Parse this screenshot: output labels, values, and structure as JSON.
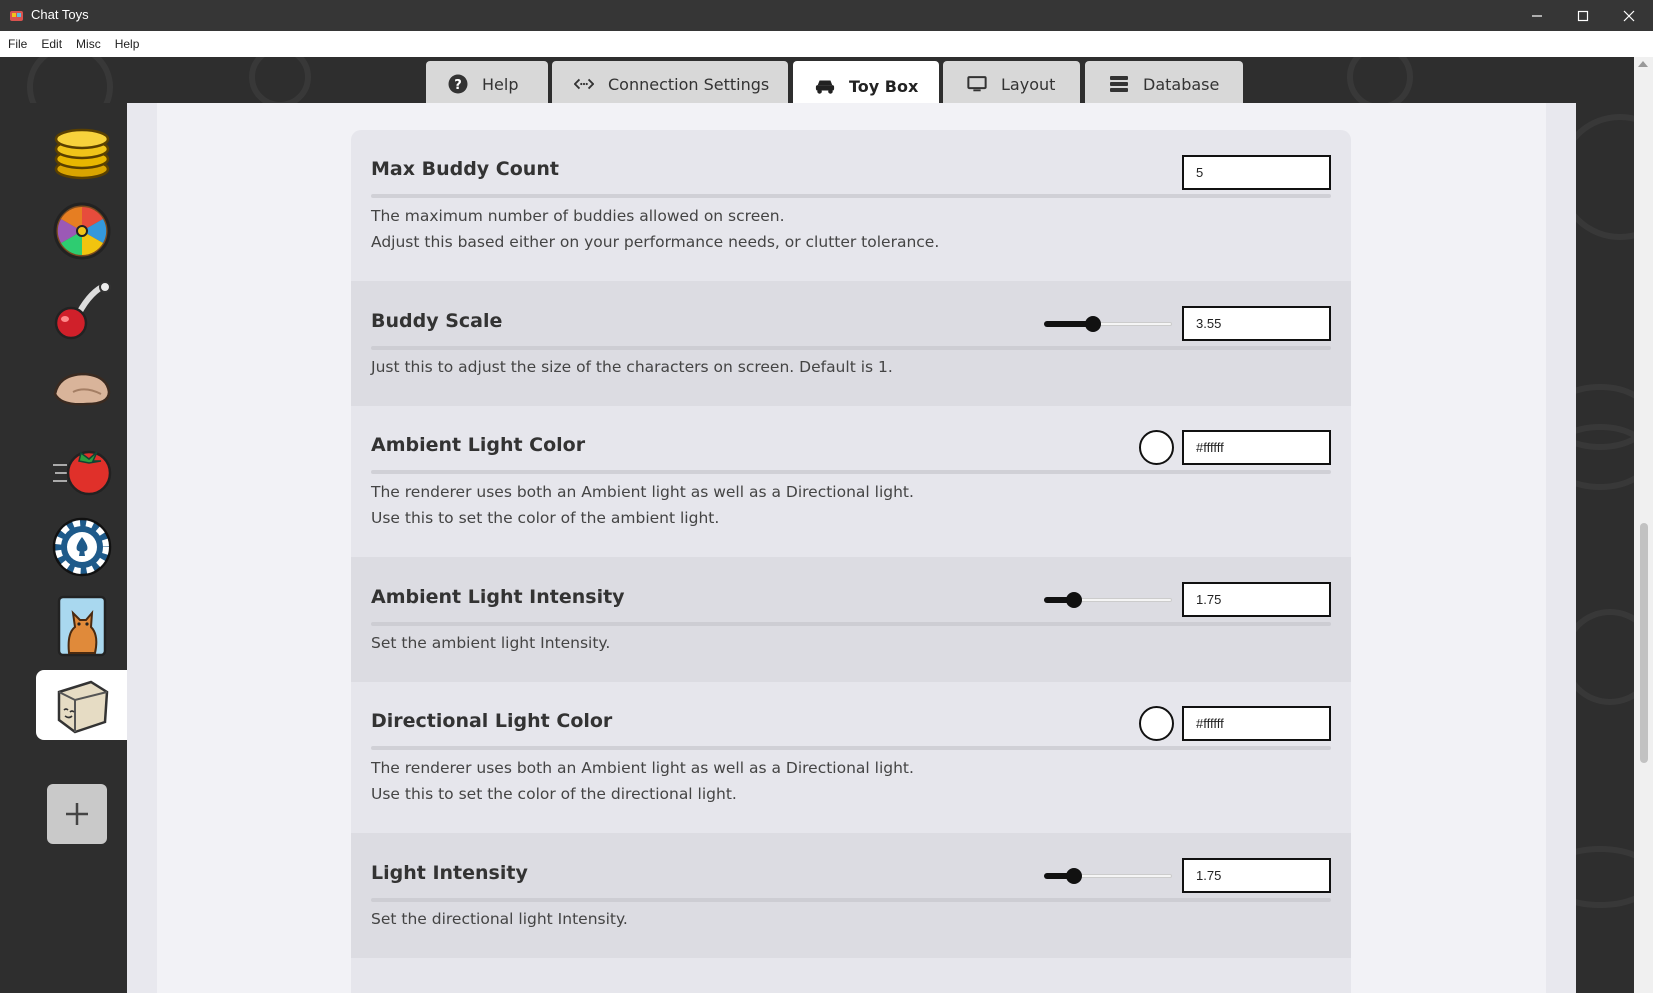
{
  "window": {
    "title": "Chat Toys"
  },
  "menu": [
    "File",
    "Edit",
    "Misc",
    "Help"
  ],
  "tabs": [
    {
      "label": "Help",
      "icon": "question-circle-icon",
      "active": false
    },
    {
      "label": "Connection Settings",
      "icon": "code-arrows-icon",
      "active": false
    },
    {
      "label": "Toy Box",
      "icon": "car-icon",
      "active": true
    },
    {
      "label": "Layout",
      "icon": "monitor-icon",
      "active": false
    },
    {
      "label": "Database",
      "icon": "database-icon",
      "active": false
    }
  ],
  "sidebar": {
    "items": [
      {
        "name": "coins-stack",
        "icon": "coins-icon"
      },
      {
        "name": "prize-wheel",
        "icon": "wheel-icon"
      },
      {
        "name": "cherry-throw",
        "icon": "cherry-icon"
      },
      {
        "name": "hand-slap",
        "icon": "hand-icon"
      },
      {
        "name": "tomato-throw",
        "icon": "tomato-icon"
      },
      {
        "name": "poker-chip",
        "icon": "chip-icon"
      },
      {
        "name": "cat-card",
        "icon": "cat-icon"
      },
      {
        "name": "buddy-box",
        "icon": "box-face-icon",
        "active": true
      }
    ],
    "add_label": "+"
  },
  "settings": [
    {
      "label": "Max Buddy Count",
      "value": "5",
      "control": "number",
      "desc": [
        "The maximum number of buddies allowed on screen.",
        "Adjust this based either on your performance needs, or clutter tolerance."
      ]
    },
    {
      "label": "Buddy Scale",
      "value": "3.55",
      "control": "slider",
      "slider_fraction": 0.37,
      "desc": [
        "Just this to adjust the size of the characters on screen. Default is 1."
      ]
    },
    {
      "label": "Ambient Light Color",
      "value": "#ffffff",
      "control": "color",
      "swatch_color": "#ffffff",
      "desc": [
        "The renderer uses both an Ambient light as well as a Directional light.",
        "Use this to set the color of the ambient light."
      ]
    },
    {
      "label": "Ambient Light Intensity",
      "value": "1.75",
      "control": "slider",
      "slider_fraction": 0.2,
      "desc": [
        "Set the ambient light Intensity."
      ]
    },
    {
      "label": "Directional Light Color",
      "value": "#ffffff",
      "control": "color",
      "swatch_color": "#ffffff",
      "desc": [
        "The renderer uses both an Ambient light as well as a Directional light.",
        "Use this to set the color of the directional light."
      ]
    },
    {
      "label": "Light Intensity",
      "value": "1.75",
      "control": "slider",
      "slider_fraction": 0.2,
      "desc": [
        "Set the directional light Intensity."
      ]
    }
  ]
}
